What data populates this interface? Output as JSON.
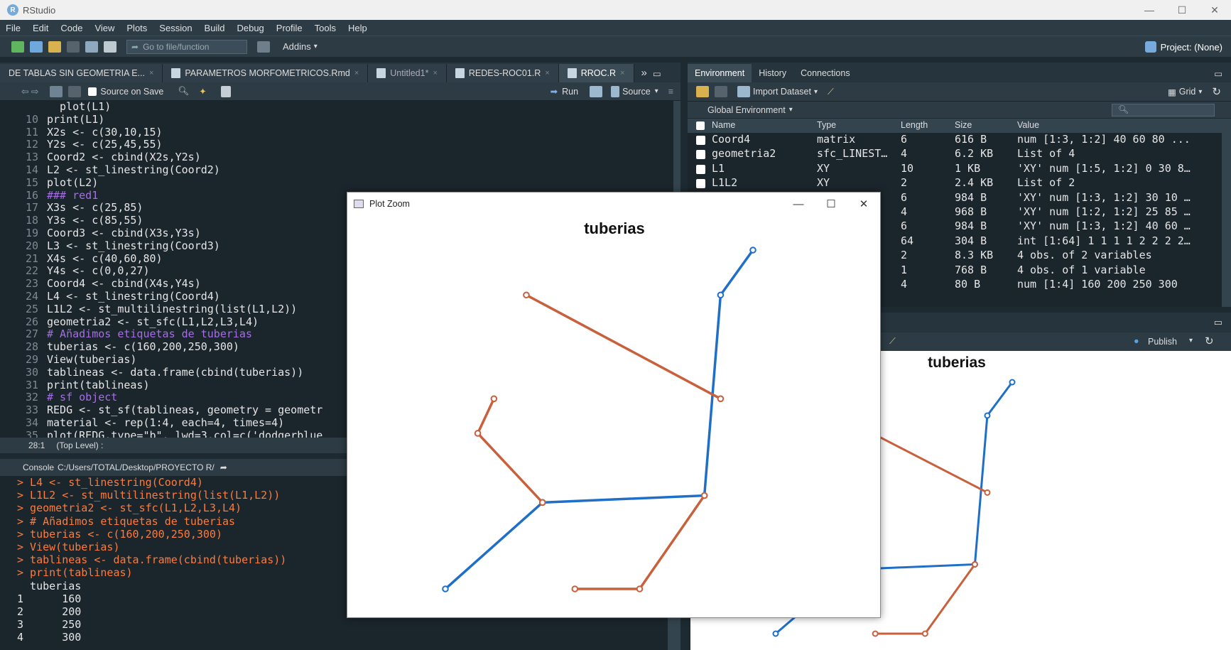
{
  "app": {
    "title": "RStudio"
  },
  "menu": [
    "File",
    "Edit",
    "Code",
    "View",
    "Plots",
    "Session",
    "Build",
    "Debug",
    "Profile",
    "Tools",
    "Help"
  ],
  "toolbar": {
    "goto_placeholder": "Go to file/function",
    "addins": "Addins",
    "project": "Project: (None)"
  },
  "editor": {
    "tabs": [
      {
        "label": "DE TABLAS SIN GEOMETRIA E...",
        "active": false
      },
      {
        "label": "PARAMETROS MORFOMETRICOS.Rmd",
        "active": false
      },
      {
        "label": "Untitled1*",
        "active": false
      },
      {
        "label": "REDES-ROC01.R",
        "active": false
      },
      {
        "label": "RROC.R",
        "active": true
      }
    ],
    "source_on_save": "Source on Save",
    "run": "Run",
    "source": "Source",
    "lines": [
      {
        "n": "",
        "t": "  plot(L1)",
        "c": false
      },
      {
        "n": "10",
        "t": "print(L1)",
        "c": false
      },
      {
        "n": "11",
        "t": "X2s <- c(30,10,15)",
        "c": false
      },
      {
        "n": "12",
        "t": "Y2s <- c(25,45,55)",
        "c": false
      },
      {
        "n": "13",
        "t": "Coord2 <- cbind(X2s,Y2s)",
        "c": false
      },
      {
        "n": "14",
        "t": "L2 <- st_linestring(Coord2)",
        "c": false
      },
      {
        "n": "15",
        "t": "plot(L2)",
        "c": false
      },
      {
        "n": "16",
        "t": "### red1",
        "c": true
      },
      {
        "n": "17",
        "t": "X3s <- c(25,85)",
        "c": false
      },
      {
        "n": "18",
        "t": "Y3s <- c(85,55)",
        "c": false
      },
      {
        "n": "19",
        "t": "Coord3 <- cbind(X3s,Y3s)",
        "c": false
      },
      {
        "n": "20",
        "t": "L3 <- st_linestring(Coord3)",
        "c": false
      },
      {
        "n": "21",
        "t": "X4s <- c(40,60,80)",
        "c": false
      },
      {
        "n": "22",
        "t": "Y4s <- c(0,0,27)",
        "c": false
      },
      {
        "n": "23",
        "t": "Coord4 <- cbind(X4s,Y4s)",
        "c": false
      },
      {
        "n": "24",
        "t": "L4 <- st_linestring(Coord4)",
        "c": false
      },
      {
        "n": "25",
        "t": "L1L2 <- st_multilinestring(list(L1,L2))",
        "c": false
      },
      {
        "n": "26",
        "t": "geometria2 <- st_sfc(L1,L2,L3,L4)",
        "c": false
      },
      {
        "n": "27",
        "t": "# Añadimos etiquetas de tuberias",
        "c": true
      },
      {
        "n": "28",
        "t": "tuberias <- c(160,200,250,300)",
        "c": false
      },
      {
        "n": "29",
        "t": "View(tuberias)",
        "c": false
      },
      {
        "n": "30",
        "t": "tablineas <- data.frame(cbind(tuberias))",
        "c": false
      },
      {
        "n": "31",
        "t": "print(tablineas)",
        "c": false
      },
      {
        "n": "32",
        "t": "# sf object",
        "c": true
      },
      {
        "n": "33",
        "t": "REDG <- st_sf(tablineas, geometry = geometr",
        "c": false
      },
      {
        "n": "34",
        "t": "material <- rep(1:4, each=4, times=4)",
        "c": false
      },
      {
        "n": "35",
        "t": "plot(REDG,type=\"b\", lwd=3,col=c('dodgerblue",
        "c": false
      }
    ],
    "status_pos": "28:1",
    "status_level": "(Top Level) :"
  },
  "console": {
    "title": "Console",
    "path": "C:/Users/TOTAL/Desktop/PROYECTO R/",
    "lines": [
      "> L4 <- st_linestring(Coord4)",
      "> L1L2 <- st_multilinestring(list(L1,L2))",
      "> geometria2 <- st_sfc(L1,L2,L3,L4)",
      "> # Añadimos etiquetas de tuberias",
      "> tuberias <- c(160,200,250,300)",
      "> View(tuberias)",
      "> tablineas <- data.frame(cbind(tuberias))",
      "> print(tablineas)"
    ],
    "output": [
      "  tuberias",
      "1      160",
      "2      200",
      "3      250",
      "4      300"
    ]
  },
  "environment": {
    "tabs": [
      "Environment",
      "History",
      "Connections"
    ],
    "import": "Import Dataset",
    "grid": "Grid",
    "scope": "Global Environment",
    "columns": [
      "Name",
      "Type",
      "Length",
      "Size",
      "Value"
    ],
    "rows": [
      {
        "name": "Coord4",
        "type": "matrix",
        "length": "6",
        "size": "616 B",
        "value": "num [1:3, 1:2] 40 60 80 ..."
      },
      {
        "name": "geometria2",
        "type": "sfc_LINEST…",
        "length": "4",
        "size": "6.2 KB",
        "value": "List of 4"
      },
      {
        "name": "L1",
        "type": "XY",
        "length": "10",
        "size": "1 KB",
        "value": "'XY' num [1:5, 1:2] 0 30 8…"
      },
      {
        "name": "L1L2",
        "type": "XY",
        "length": "2",
        "size": "2.4 KB",
        "value": "List of 2"
      },
      {
        "name": "",
        "type": "",
        "length": "6",
        "size": "984 B",
        "value": "'XY' num [1:3, 1:2] 30 10 …"
      },
      {
        "name": "",
        "type": "",
        "length": "4",
        "size": "968 B",
        "value": "'XY' num [1:2, 1:2] 25 85 …"
      },
      {
        "name": "",
        "type": "",
        "length": "6",
        "size": "984 B",
        "value": "'XY' num [1:3, 1:2] 40 60 …"
      },
      {
        "name": "",
        "type": "",
        "length": "64",
        "size": "304 B",
        "value": "int [1:64] 1 1 1 1 2 2 2 2…"
      },
      {
        "name": "",
        "type": "",
        "length": "2",
        "size": "8.3 KB",
        "value": "4 obs. of 2 variables"
      },
      {
        "name": "",
        "type": "e",
        "length": "1",
        "size": "768 B",
        "value": "4 obs. of 1 variable"
      },
      {
        "name": "",
        "type": "",
        "length": "4",
        "size": "80 B",
        "value": "num [1:4] 160 200 250 300"
      }
    ]
  },
  "plots": {
    "publish": "Publish"
  },
  "zoom_window": {
    "title": "Plot Zoom"
  },
  "chart_data": {
    "type": "line",
    "title": "tuberias",
    "colors": {
      "blue": "#1f6fc9",
      "red": "#c9603c"
    },
    "series": [
      {
        "color": "blue",
        "x": [
          0,
          30,
          80,
          85,
          95
        ],
        "y": [
          0,
          25,
          27,
          85,
          98
        ]
      },
      {
        "color": "red",
        "x": [
          30,
          10,
          15
        ],
        "y": [
          25,
          45,
          55
        ]
      },
      {
        "color": "red",
        "x": [
          25,
          85
        ],
        "y": [
          85,
          55
        ]
      },
      {
        "color": "red",
        "x": [
          40,
          60,
          80
        ],
        "y": [
          0,
          0,
          27
        ]
      }
    ],
    "xlim": [
      0,
      95
    ],
    "ylim": [
      0,
      98
    ],
    "axes": false
  }
}
